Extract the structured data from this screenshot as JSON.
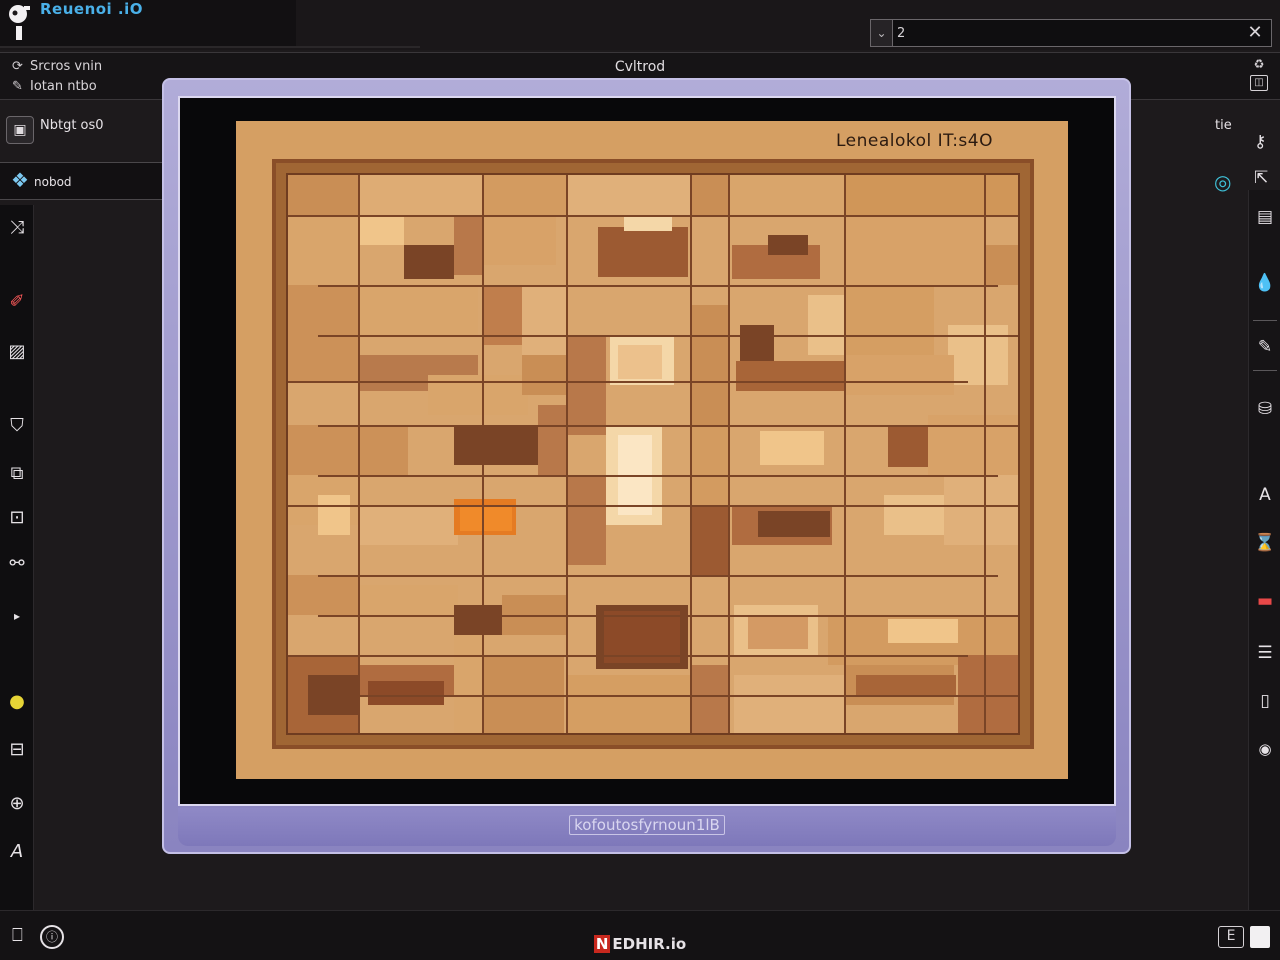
{
  "window": {
    "app_title": "Reuenoi .iO",
    "document_title": "Cvltrod"
  },
  "search": {
    "value": "2",
    "toggle_icon": "chevron-down-icon",
    "close_icon": "close-icon"
  },
  "menu": {
    "line_1": "Srcros vnin",
    "line_2": "Iotan ntbo",
    "right_icon": "recycle-icon"
  },
  "left_panel": {
    "row_1_label": "Nbtgt os0",
    "row_2_label": "nobod"
  },
  "right_panel": {
    "top_label": "tie"
  },
  "board": {
    "label": "Lenealokol  IT:s4O",
    "highlight_color": "#e57b22",
    "board_color": "#d59f63"
  },
  "dialog": {
    "footer_label": "kofoutosfyrnoun1lB"
  },
  "status": {
    "center_badge": "N",
    "center_label": "EDHIR.io",
    "right_label": "E"
  }
}
